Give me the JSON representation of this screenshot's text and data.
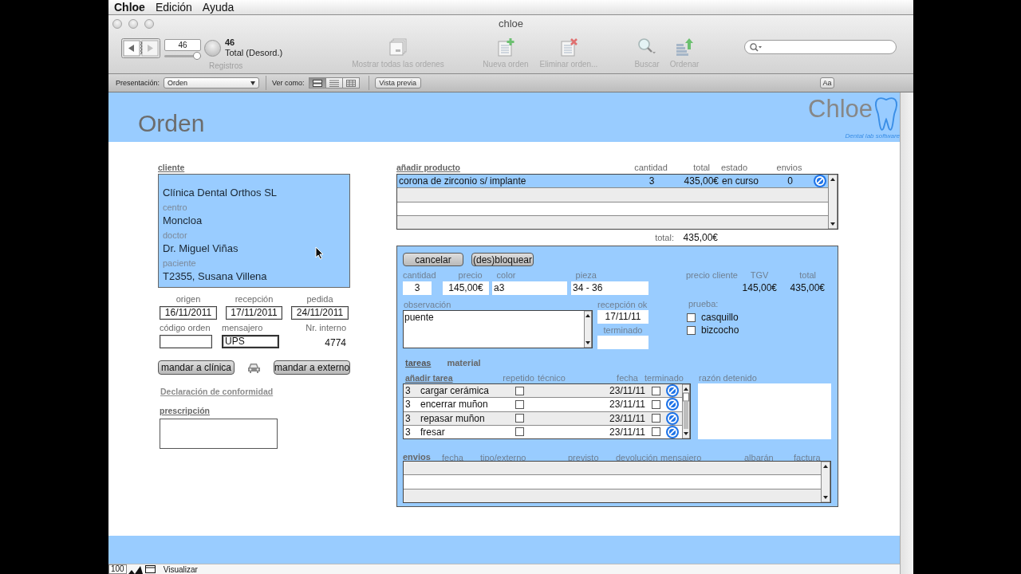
{
  "menu_bar": {
    "items": [
      "Chloe",
      "Edición",
      "Ayuda"
    ]
  },
  "window": {
    "title": "chloe"
  },
  "toolbar": {
    "record_field": "46",
    "record_slider": {
      "level": 1
    },
    "record_count": "46",
    "record_status": "Total (Desord.)",
    "records_label": "Registros",
    "actions": [
      {
        "kind": "show-all",
        "label": "Mostrar todas las ordenes"
      },
      {
        "kind": "new",
        "label": "Nueva orden"
      },
      {
        "kind": "delete",
        "label": "Eliminar orden..."
      },
      {
        "kind": "find",
        "label": "Buscar"
      },
      {
        "kind": "sort",
        "label": "Ordenar"
      }
    ]
  },
  "layout_bar": {
    "layout_label": "Presentación:",
    "layout_value": "Orden",
    "view_label": "Ver como:",
    "view_modes": [
      {
        "kind": "form",
        "selected": true
      },
      {
        "kind": "list",
        "selected": false
      },
      {
        "kind": "table",
        "selected": false
      }
    ],
    "preview_button": "Vista previa",
    "text_button": "Aa"
  },
  "header": {
    "title": "Orden",
    "logo_text": "Chloe",
    "logo_tagline": "Dental lab software"
  },
  "client": {
    "heading": "cliente",
    "name": "Clínica Dental Orthos SL",
    "fields": [
      {
        "label": "centro",
        "value": "Moncloa"
      },
      {
        "label": "doctor",
        "value": "Dr. Miguel Viñas"
      },
      {
        "label": "paciente",
        "value": "T2355, Susana Villena"
      }
    ]
  },
  "dates": [
    {
      "label": "origen",
      "value": "16/11/2011"
    },
    {
      "label": "recepción",
      "value": "17/11/2011"
    },
    {
      "label": "pedida",
      "value": "24/11/2011"
    }
  ],
  "order_code": {
    "label": "código orden"
  },
  "courier": {
    "label": "mensajero",
    "value": "UPS"
  },
  "internal_number": {
    "label": "Nr. interno",
    "value": "4774"
  },
  "send_buttons": [
    "mandar a clínica",
    "mandar a externo"
  ],
  "conformity_link": "Declaración de conformidad",
  "prescription": {
    "label": "prescripción"
  },
  "products": {
    "add_link": "añadir producto",
    "columns": [
      "cantidad",
      "total",
      "estado",
      "envios"
    ],
    "rows": [
      {
        "name": "corona de zirconio s/ implante",
        "quantity": "3",
        "total": "435,00€",
        "status": "en curso",
        "shipments": "0",
        "selected": true
      }
    ],
    "total_label": "total:",
    "total_value": "435,00€"
  },
  "detail": {
    "buttons": [
      "cancelar",
      "(des)bloquear"
    ],
    "fields": [
      {
        "label": "cantidad",
        "value": "3"
      },
      {
        "label": "precio",
        "value": "145,00€"
      },
      {
        "label": "color",
        "value": "a3"
      },
      {
        "label": "pieza",
        "value": "34 - 36"
      }
    ],
    "price_columns": [
      "precio cliente",
      "TGV",
      "total"
    ],
    "tgv": "145,00€",
    "total": "435,00€",
    "observation": {
      "label": "observación",
      "value": "puente"
    },
    "reception_ok": {
      "label": "recepción ok",
      "value": "17/11/11"
    },
    "finished": {
      "label": "terminado"
    },
    "test": {
      "label": "prueba:",
      "options": [
        {
          "label": "casquillo",
          "checked": false
        },
        {
          "label": "bizcocho",
          "checked": false
        }
      ]
    },
    "tabs": [
      {
        "label": "tareas",
        "selected": true
      },
      {
        "label": "material",
        "selected": false
      }
    ],
    "tasks": {
      "add_link": "añadir tarea",
      "columns": [
        "repetido",
        "técnico",
        "fecha",
        "terminado"
      ],
      "rows": [
        {
          "quantity": "3",
          "name": "cargar cerámica",
          "repeated": false,
          "date": "23/11/11",
          "finished": false
        },
        {
          "quantity": "3",
          "name": "encerrar muñon",
          "repeated": false,
          "date": "23/11/11",
          "finished": false
        },
        {
          "quantity": "3",
          "name": "repasar muñon",
          "repeated": false,
          "date": "23/11/11",
          "finished": false
        },
        {
          "quantity": "3",
          "name": "fresar",
          "repeated": false,
          "date": "23/11/11",
          "finished": false
        }
      ]
    },
    "stop_reason": {
      "label": "razón detenido"
    },
    "shipments": {
      "title": "envios",
      "columns": [
        "fecha",
        "tipo/externo",
        "previsto",
        "devolución",
        "mensajero",
        "albarán",
        "factura"
      ]
    }
  },
  "status_bar": {
    "zoom": "100",
    "mode": "Visualizar"
  }
}
